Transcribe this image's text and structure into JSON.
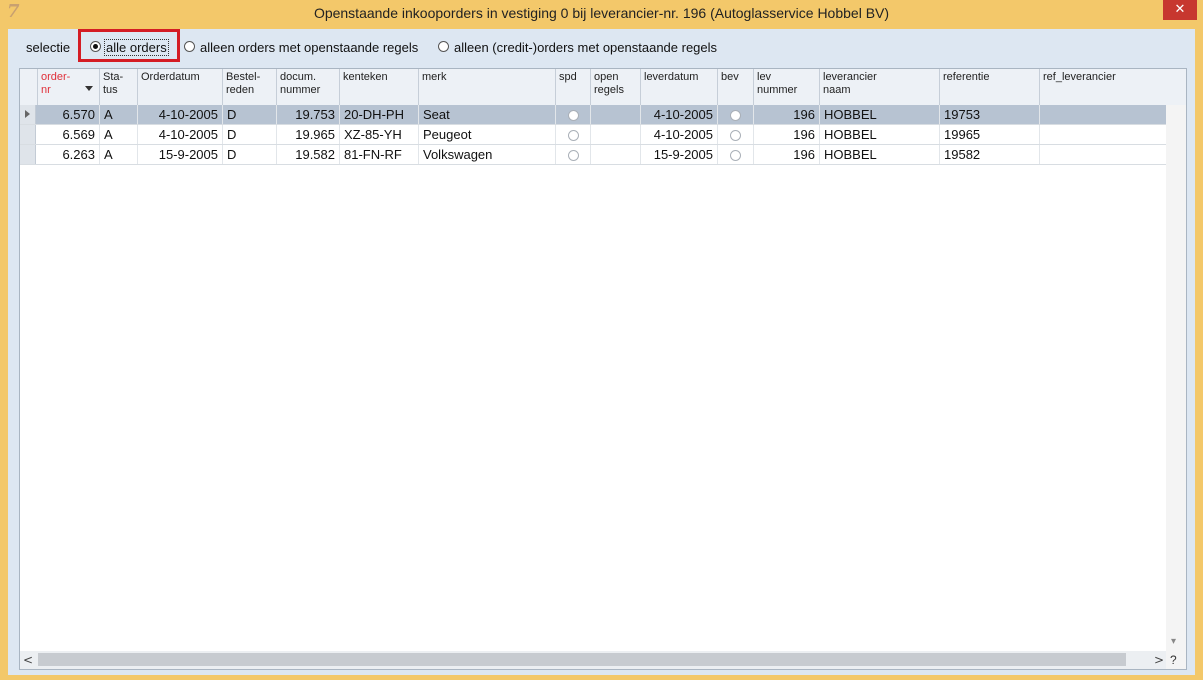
{
  "window": {
    "title": "Openstaande inkooporders in vestiging 0 bij leverancier-nr. 196 (Autoglasservice Hobbel BV)",
    "app_icon": "7",
    "close_label": "✕"
  },
  "selection": {
    "label": "selectie",
    "options": [
      {
        "label": "alle orders",
        "checked": true
      },
      {
        "label": "alleen orders met openstaande regels",
        "checked": false
      },
      {
        "label": "alleen (credit-)orders met openstaande regels",
        "checked": false
      }
    ]
  },
  "table": {
    "columns": [
      {
        "line1": "order-",
        "line2": "nr",
        "sorted": true
      },
      {
        "line1": "Sta-",
        "line2": "tus"
      },
      {
        "line1": "Orderdatum",
        "line2": ""
      },
      {
        "line1": "Bestel-",
        "line2": "reden"
      },
      {
        "line1": "docum.",
        "line2": "nummer"
      },
      {
        "line1": "kenteken",
        "line2": ""
      },
      {
        "line1": "merk",
        "line2": ""
      },
      {
        "line1": "spd",
        "line2": ""
      },
      {
        "line1": "open",
        "line2": "regels"
      },
      {
        "line1": "leverdatum",
        "line2": ""
      },
      {
        "line1": "bev",
        "line2": ""
      },
      {
        "line1": "lev",
        "line2": "nummer"
      },
      {
        "line1": "leverancier",
        "line2": "naam"
      },
      {
        "line1": "referentie",
        "line2": ""
      },
      {
        "line1": "ref_leverancier",
        "line2": ""
      }
    ],
    "rows": [
      {
        "order_nr": "6.570",
        "status": "A",
        "orderdatum": "4-10-2005",
        "reden": "D",
        "docum": "19.753",
        "kenteken": "20-DH-PH",
        "merk": "Seat",
        "open": "",
        "leverdatum": "4-10-2005",
        "lev_nummer": "196",
        "lev_naam": "HOBBEL",
        "referentie": "19753",
        "ref_lev": ""
      },
      {
        "order_nr": "6.569",
        "status": "A",
        "orderdatum": "4-10-2005",
        "reden": "D",
        "docum": "19.965",
        "kenteken": "XZ-85-YH",
        "merk": "Peugeot",
        "open": "",
        "leverdatum": "4-10-2005",
        "lev_nummer": "196",
        "lev_naam": "HOBBEL",
        "referentie": "19965",
        "ref_lev": ""
      },
      {
        "order_nr": "6.263",
        "status": "A",
        "orderdatum": "15-9-2005",
        "reden": "D",
        "docum": "19.582",
        "kenteken": "81-FN-RF",
        "merk": "Volkswagen",
        "open": "",
        "leverdatum": "15-9-2005",
        "lev_nummer": "196",
        "lev_naam": "HOBBEL",
        "referentie": "19582",
        "ref_lev": ""
      }
    ]
  },
  "footer": {
    "scroll_left": "<",
    "scroll_right": ">",
    "help": "?",
    "scroll_down": "▾"
  },
  "colors": {
    "frame": "#f3c86a",
    "client": "#dde7f2",
    "selected_row": "#b7c3d2",
    "sorted_header": "#e0303a",
    "focus_box": "#d41c24"
  }
}
